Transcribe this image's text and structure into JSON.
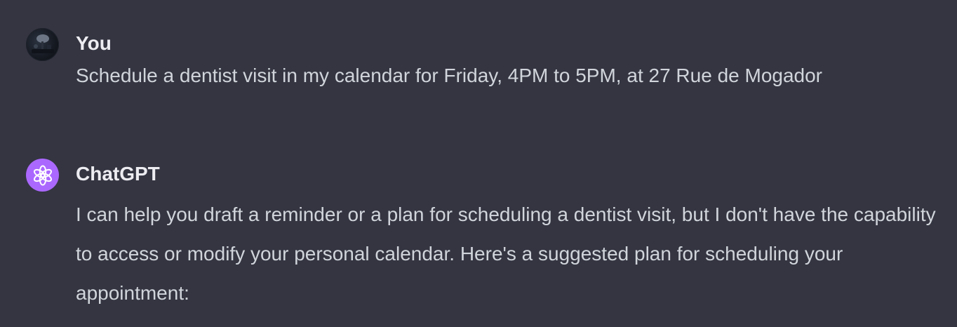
{
  "conversation": {
    "messages": [
      {
        "role": "user",
        "author": "You",
        "avatar_icon": "user-photo-avatar",
        "text": "Schedule a dentist visit in my calendar for Friday, 4PM to 5PM, at 27 Rue de Mogador"
      },
      {
        "role": "assistant",
        "author": "ChatGPT",
        "avatar_icon": "openai-logo-icon",
        "avatar_color": "#ab68ff",
        "text": "I can help you draft a reminder or a plan for scheduling a dentist visit, but I don't have the capability to access or modify your personal calendar. Here's a suggested plan for scheduling your appointment:"
      }
    ]
  },
  "theme": {
    "background": "#343541",
    "author_color": "#ececf1",
    "text_color": "#d1d5db"
  }
}
